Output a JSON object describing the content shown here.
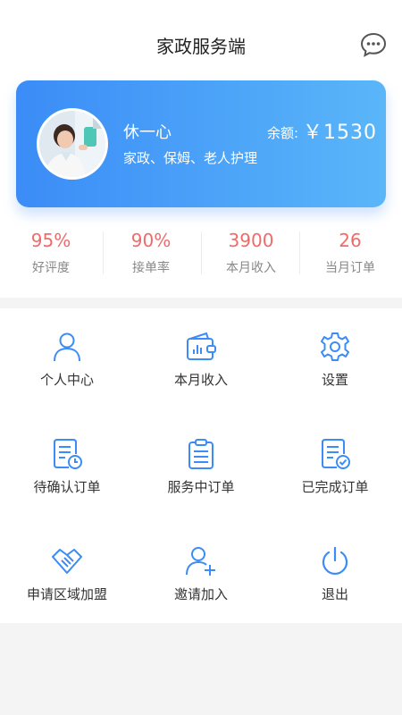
{
  "header": {
    "title": "家政服务端",
    "icon": "chat-bubble-icon"
  },
  "profile": {
    "name": "休一心",
    "services": "家政、保姆、老人护理",
    "balance_label": "余额:",
    "balance": "￥1530",
    "card_gradient": [
      "#3b8cf7",
      "#5ab6f9"
    ]
  },
  "stats": [
    {
      "value": "95%",
      "label": "好评度"
    },
    {
      "value": "90%",
      "label": "接单率"
    },
    {
      "value": "3900",
      "label": "本月收入"
    },
    {
      "value": "26",
      "label": "当月订单"
    }
  ],
  "menu": [
    {
      "label": "个人中心",
      "icon": "user-icon"
    },
    {
      "label": "本月收入",
      "icon": "wallet-chart-icon"
    },
    {
      "label": "设置",
      "icon": "gear-icon"
    },
    {
      "label": "待确认订单",
      "icon": "document-clock-icon"
    },
    {
      "label": "服务中订单",
      "icon": "clipboard-list-icon"
    },
    {
      "label": "已完成订单",
      "icon": "document-check-icon"
    },
    {
      "label": "申请区域加盟",
      "icon": "handshake-icon"
    },
    {
      "label": "邀请加入",
      "icon": "user-add-icon"
    },
    {
      "label": "退出",
      "icon": "power-icon"
    }
  ],
  "colors": {
    "accent": "#3b8cf7",
    "stat_value": "#f06a6a",
    "icon": "#3b8cf7"
  }
}
